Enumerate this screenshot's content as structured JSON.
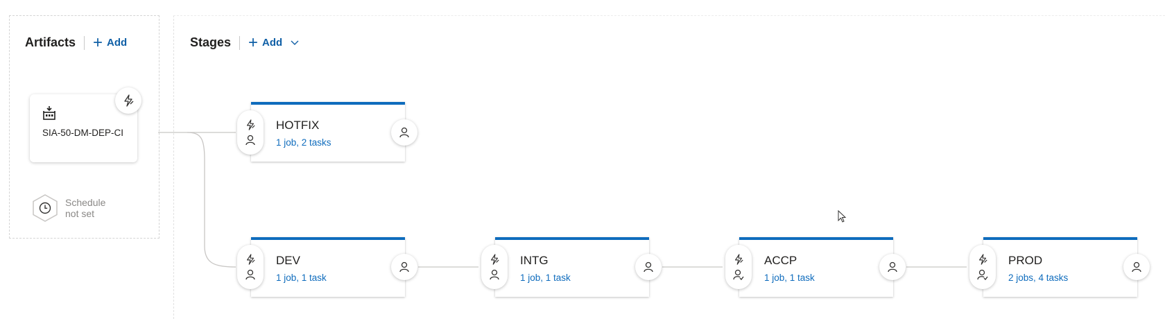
{
  "artifacts": {
    "title": "Artifacts",
    "add_label": "Add",
    "artifact": {
      "name": "SIA-50-DM-DEP-CI",
      "icon": "build-pipeline-icon"
    },
    "schedule": {
      "label_line1": "Schedule",
      "label_line2": "not set",
      "icon": "clock-icon"
    }
  },
  "stages_header": {
    "title": "Stages",
    "add_label": "Add"
  },
  "stages": [
    {
      "name": "HOTFIX",
      "summary": "1 job, 2 tasks"
    },
    {
      "name": "DEV",
      "summary": "1 job, 1 task"
    },
    {
      "name": "INTG",
      "summary": "1 job, 1 task"
    },
    {
      "name": "ACCP",
      "summary": "1 job, 1 task"
    },
    {
      "name": "PROD",
      "summary": "2 jobs, 4 tasks"
    }
  ],
  "colors": {
    "accent": "#0f6cbd",
    "link": "#0f5fa6",
    "muted": "#8a8886"
  }
}
